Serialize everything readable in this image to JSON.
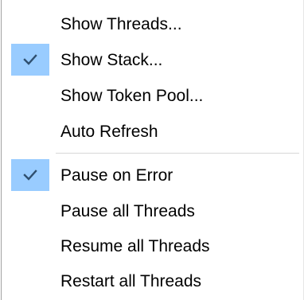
{
  "menu": {
    "group1": [
      {
        "label": "Show Threads...",
        "checked": false
      },
      {
        "label": "Show Stack...",
        "checked": true
      },
      {
        "label": "Show Token Pool...",
        "checked": false
      },
      {
        "label": "Auto Refresh",
        "checked": false
      }
    ],
    "group2": [
      {
        "label": "Pause on Error",
        "checked": true
      },
      {
        "label": "Pause all Threads",
        "checked": false
      },
      {
        "label": "Resume all Threads",
        "checked": false
      },
      {
        "label": "Restart all Threads",
        "checked": false
      }
    ]
  },
  "colors": {
    "check_background": "#99ccff",
    "checkmark": "#2f4f6f"
  },
  "icons": {
    "checkmark": "checkmark-icon"
  }
}
